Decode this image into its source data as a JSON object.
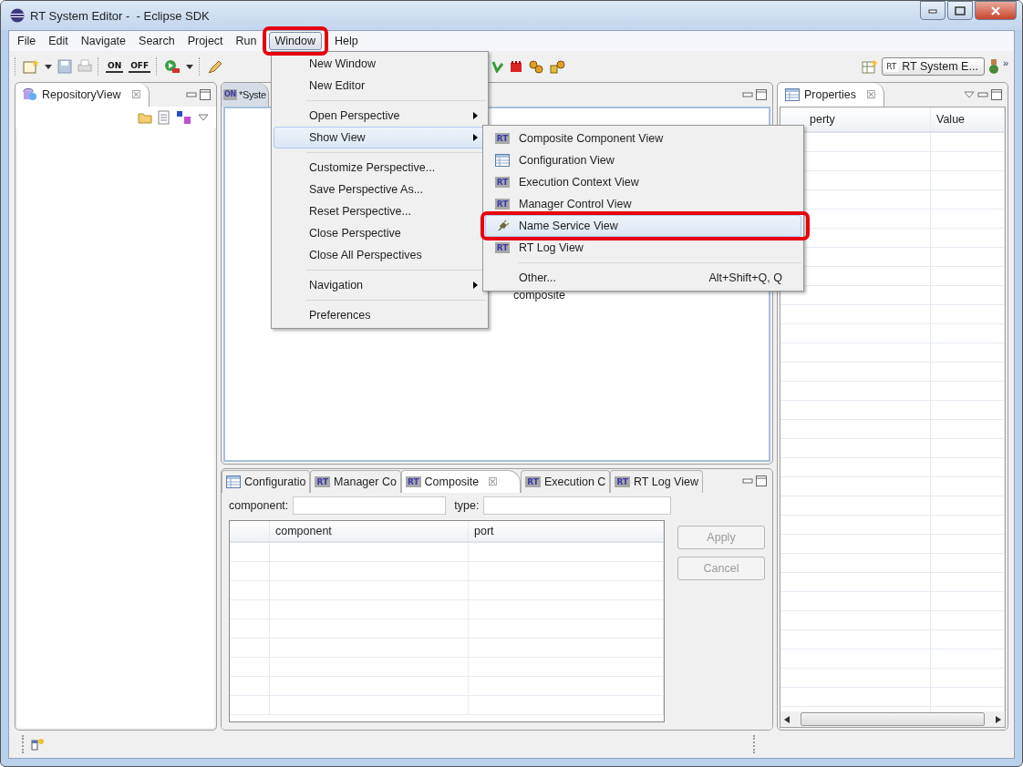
{
  "window": {
    "title": "RT System Editor -  - Eclipse SDK"
  },
  "menu_bar": [
    {
      "label": "File",
      "selected": false,
      "annotated": false
    },
    {
      "label": "Edit",
      "selected": false,
      "annotated": false
    },
    {
      "label": "Navigate",
      "selected": false,
      "annotated": false
    },
    {
      "label": "Search",
      "selected": false,
      "annotated": false
    },
    {
      "label": "Project",
      "selected": false,
      "annotated": false
    },
    {
      "label": "Run",
      "selected": false,
      "annotated": false
    },
    {
      "label": "Window",
      "selected": true,
      "annotated": true
    },
    {
      "label": "Help",
      "selected": false,
      "annotated": false
    }
  ],
  "toolbar": {
    "badges": [
      "ON",
      "OFF"
    ],
    "perspective": {
      "badge": "RT",
      "label": "RT System E..."
    },
    "overflow": "»"
  },
  "window_menu": [
    {
      "kind": "item",
      "label": "New Window",
      "submenu": false,
      "selected": false
    },
    {
      "kind": "item",
      "label": "New Editor",
      "submenu": false,
      "selected": false
    },
    {
      "kind": "separator"
    },
    {
      "kind": "item",
      "label": "Open Perspective",
      "submenu": true,
      "selected": false
    },
    {
      "kind": "item",
      "label": "Show View",
      "submenu": true,
      "selected": true
    },
    {
      "kind": "separator"
    },
    {
      "kind": "item",
      "label": "Customize Perspective...",
      "submenu": false,
      "selected": false
    },
    {
      "kind": "item",
      "label": "Save Perspective As...",
      "submenu": false,
      "selected": false
    },
    {
      "kind": "item",
      "label": "Reset Perspective...",
      "submenu": false,
      "selected": false
    },
    {
      "kind": "item",
      "label": "Close Perspective",
      "submenu": false,
      "selected": false
    },
    {
      "kind": "item",
      "label": "Close All Perspectives",
      "submenu": false,
      "selected": false
    },
    {
      "kind": "separator"
    },
    {
      "kind": "item",
      "label": "Navigation",
      "submenu": true,
      "selected": false
    },
    {
      "kind": "separator"
    },
    {
      "kind": "item",
      "label": "Preferences",
      "submenu": false,
      "selected": false
    }
  ],
  "show_view_menu": [
    {
      "kind": "badge",
      "badge": "RT",
      "label": "Composite Component View",
      "selected": false,
      "annotated": false
    },
    {
      "kind": "table",
      "label": "Configuration View",
      "selected": false,
      "annotated": false
    },
    {
      "kind": "badge",
      "badge": "RT",
      "label": "Execution Context View",
      "selected": false,
      "annotated": false
    },
    {
      "kind": "badge",
      "badge": "RT",
      "label": "Manager Control View",
      "selected": false,
      "annotated": false
    },
    {
      "kind": "plug",
      "label": "Name Service View",
      "selected": true,
      "annotated": true
    },
    {
      "kind": "badge",
      "badge": "RT",
      "label": "RT Log View",
      "selected": false,
      "annotated": false
    },
    {
      "kind": "separator"
    },
    {
      "kind": "plain",
      "label": "Other...",
      "shortcut": "Alt+Shift+Q, Q",
      "selected": false,
      "annotated": false
    }
  ],
  "repository_view": {
    "title": "RepositoryView",
    "close": "☒"
  },
  "editor": {
    "tab": {
      "badge": "ON",
      "label": "*Syste"
    },
    "canvas_labels": [
      "composite"
    ]
  },
  "bottom_view": {
    "tabs": [
      {
        "kind": "table",
        "label": "Configuratio",
        "selected": false
      },
      {
        "kind": "badge",
        "badge": "RT",
        "label": "Manager Co",
        "selected": false
      },
      {
        "kind": "badge",
        "badge": "RT",
        "label": "Composite",
        "selected": true,
        "close": "☒"
      },
      {
        "kind": "badge",
        "badge": "RT",
        "label": "Execution C",
        "selected": false
      },
      {
        "kind": "badge",
        "badge": "RT",
        "label": "RT Log View",
        "selected": false
      }
    ],
    "fields": [
      {
        "label": "component:"
      },
      {
        "label": "type:"
      }
    ],
    "table": {
      "columns": [
        "component",
        "port"
      ]
    },
    "buttons": [
      {
        "label": "Apply",
        "disabled": true
      },
      {
        "label": "Cancel",
        "disabled": true
      }
    ]
  },
  "properties_view": {
    "title": "Properties",
    "close": "☒",
    "columns": [
      "perty",
      "Value"
    ]
  }
}
